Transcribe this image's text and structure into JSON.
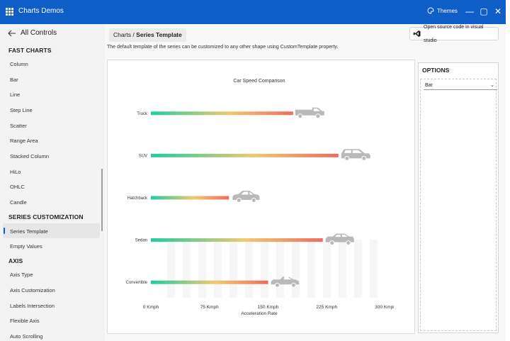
{
  "titlebar": {
    "title": "Charts Demos",
    "themes_label": "Themes",
    "minimize": "—",
    "maximize": "▢",
    "close": "✕"
  },
  "sidebar": {
    "back_label": "All Controls",
    "groups": [
      {
        "title": "FAST CHARTS",
        "items": [
          "Column",
          "Bar",
          "Line",
          "Step Line",
          "Scatter",
          "Range Area",
          "Stacked Column",
          "HiLo",
          "OHLC",
          "Candle"
        ]
      },
      {
        "title": "SERIES CUSTOMIZATION",
        "items": [
          "Series Template",
          "Empty Values"
        ]
      },
      {
        "title": "AXIS",
        "items": [
          "Axis Type",
          "Axis Customization",
          "Labels Intersection",
          "Flexible Axis",
          "Auto Scrolling"
        ]
      }
    ],
    "selected": "Series Template"
  },
  "main": {
    "breadcrumb_parent": "Charts",
    "breadcrumb_sep": "/",
    "breadcrumb_current": "Series Template",
    "source_button": "Open source code in visual studio",
    "description": "The default template of the series can be customized to any other shape using CustomTemplate property."
  },
  "options": {
    "title": "OPTIONS",
    "selected_value": "Bar"
  },
  "colors": {
    "accent": "#0f5ec7",
    "bar_start": "#1fcca3",
    "bar_mid": "#f0c96e",
    "bar_end": "#ef6b5e",
    "vehicle": "#b9b9b9"
  },
  "chart_data": {
    "type": "bar",
    "orientation": "horizontal",
    "title": "Car Speed Comparison",
    "xlabel": "Acceleration Rate",
    "ylabel": "",
    "categories": [
      "Truck",
      "SUV",
      "Hatchback",
      "Sedan",
      "Convertible"
    ],
    "values": [
      182,
      240,
      100,
      220,
      150
    ],
    "icons": [
      "truck-icon",
      "suv-icon",
      "hatchback-icon",
      "sedan-icon",
      "convertible-icon"
    ],
    "xlim": [
      0,
      300
    ],
    "ticks": [
      0,
      75,
      150,
      225,
      300
    ],
    "tick_labels": [
      "0 Kmph",
      "75 Kmph",
      "150 Kmph",
      "225 Kmph",
      "300 Kmph"
    ],
    "grid": false
  }
}
